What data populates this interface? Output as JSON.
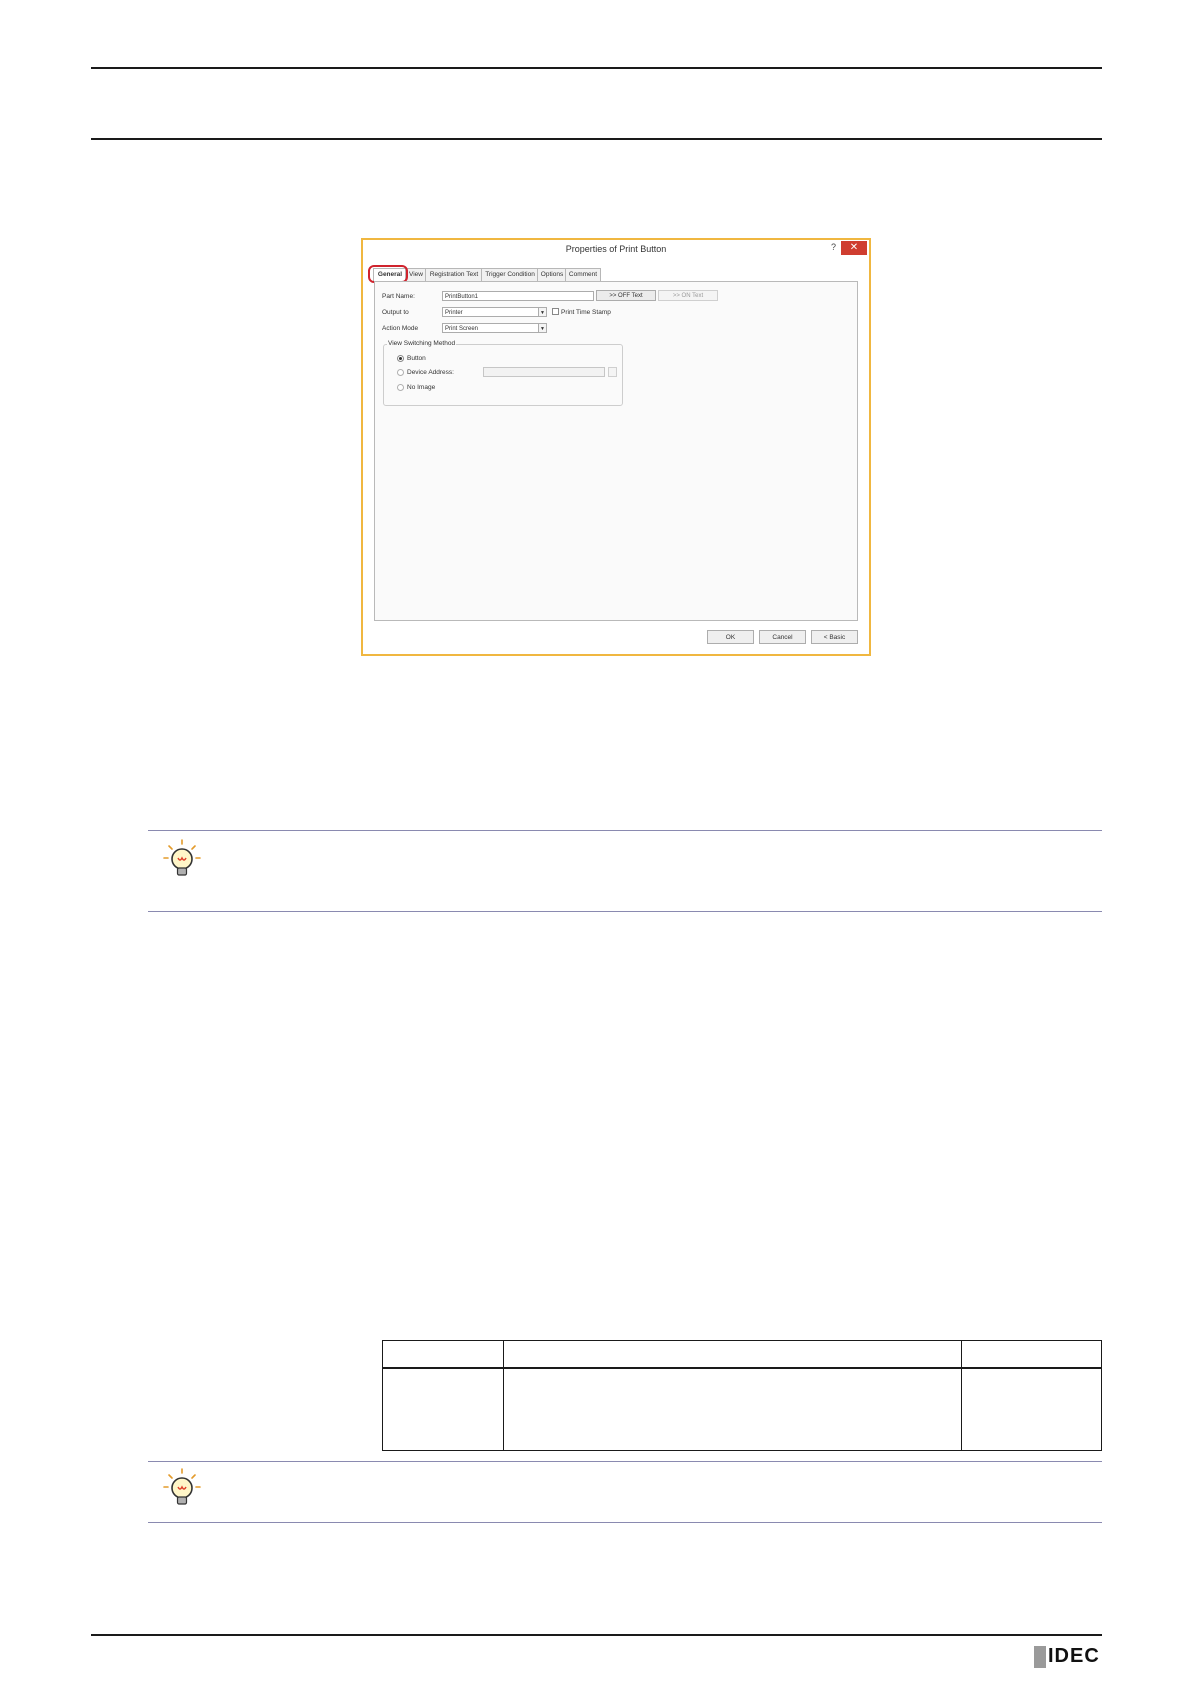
{
  "dialog": {
    "title": "Properties of Print Button",
    "help_glyph": "?",
    "close_glyph": "✕",
    "tabs": [
      "General",
      "View",
      "Registration Text",
      "Trigger Condition",
      "Options",
      "Comment"
    ],
    "part_name": {
      "label": "Part Name:",
      "value": "PrintButton1"
    },
    "off_text_button": ">> OFF Text",
    "on_text_button": ">> ON Text",
    "output_to": {
      "label": "Output to",
      "value": "Printer"
    },
    "print_time_stamp": "Print Time Stamp",
    "action_mode": {
      "label": "Action Mode",
      "value": "Print Screen"
    },
    "view_switching": {
      "title": "View Switching Method",
      "options": [
        "Button",
        "Device Address:",
        "No Image"
      ],
      "selected": "Button"
    },
    "ok": "OK",
    "cancel": "Cancel",
    "basic": "< Basic"
  },
  "logo": {
    "text": "IDEC"
  }
}
